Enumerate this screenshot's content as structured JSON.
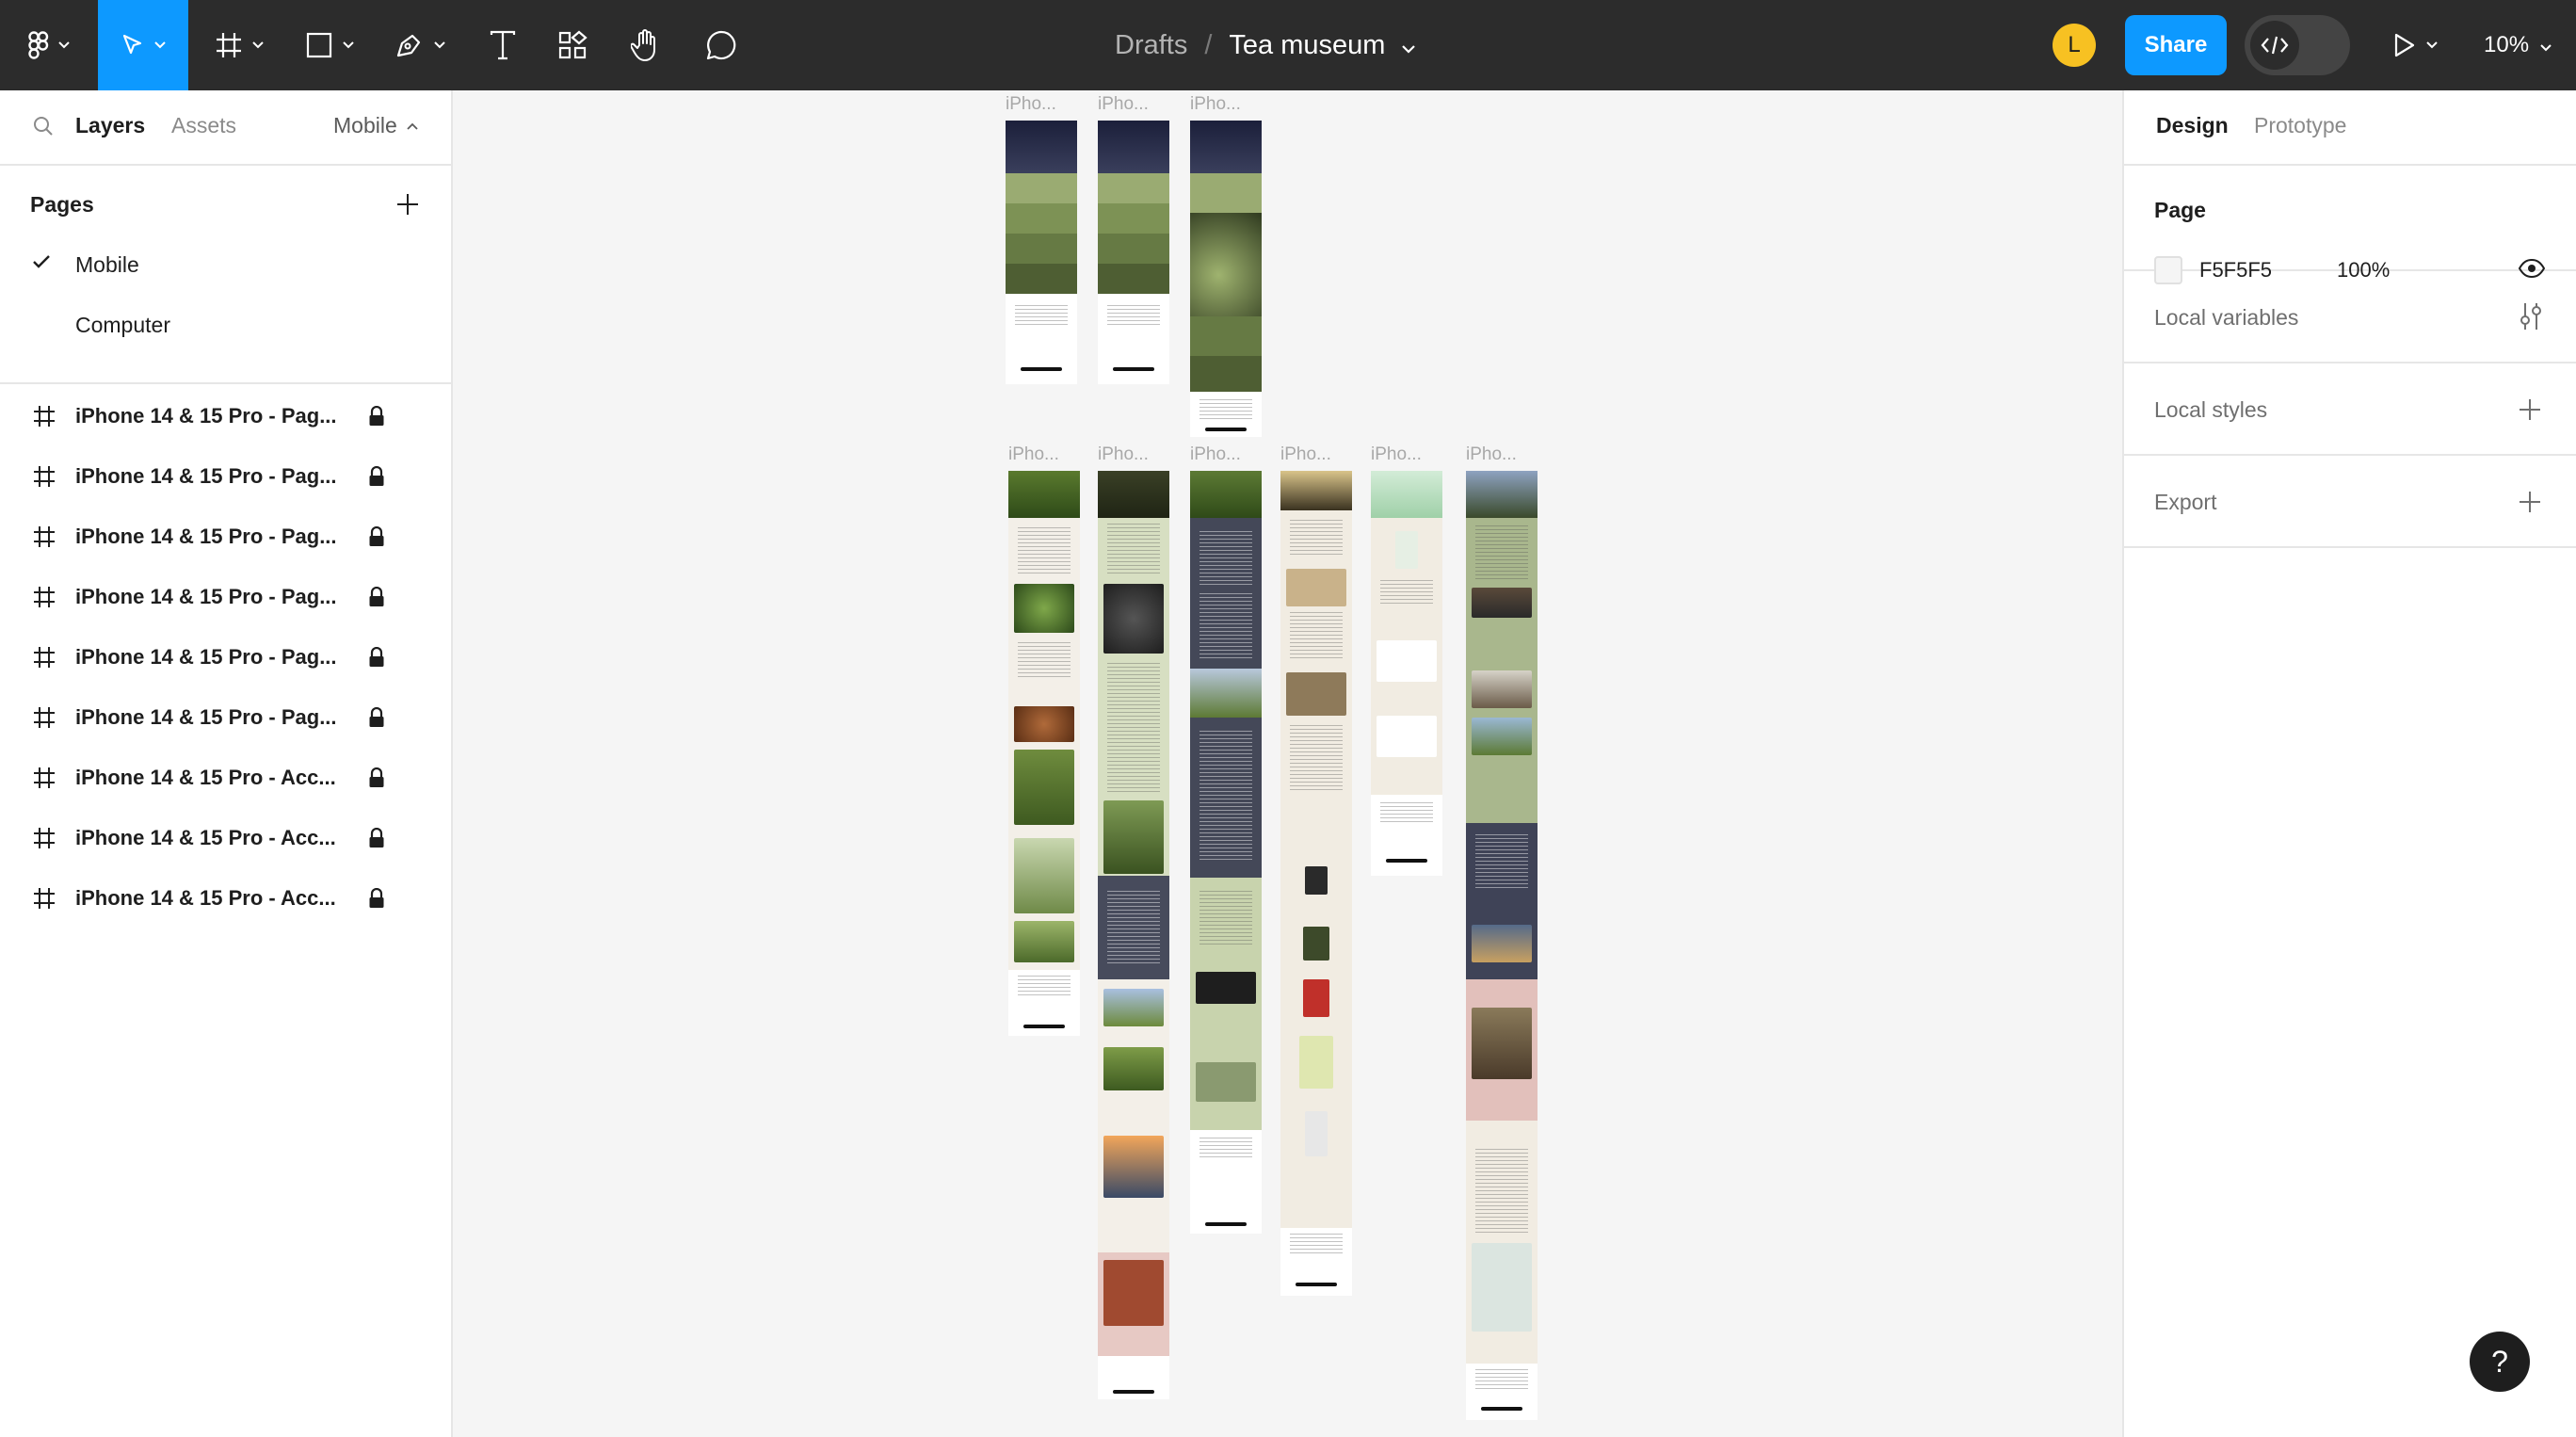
{
  "toolbar": {
    "breadcrumb_drafts": "Drafts",
    "breadcrumb_sep": "/",
    "file_name": "Tea museum",
    "avatar_initial": "L",
    "share_label": "Share",
    "zoom_label": "10%",
    "accent": "#0d99ff"
  },
  "left_panel": {
    "tab_layers": "Layers",
    "tab_assets": "Assets",
    "page_dropdown": "Mobile",
    "pages_header": "Pages",
    "pages": [
      {
        "label": "Mobile",
        "selected": true
      },
      {
        "label": "Computer",
        "selected": false
      }
    ],
    "layers": [
      {
        "label": "iPhone 14 & 15 Pro - Pag..."
      },
      {
        "label": "iPhone 14 & 15 Pro - Pag..."
      },
      {
        "label": "iPhone 14 & 15 Pro - Pag..."
      },
      {
        "label": "iPhone 14 & 15 Pro - Pag..."
      },
      {
        "label": "iPhone 14 & 15 Pro - Pag..."
      },
      {
        "label": "iPhone 14 & 15 Pro - Pag..."
      },
      {
        "label": "iPhone 14 & 15 Pro - Acc..."
      },
      {
        "label": "iPhone 14 & 15 Pro - Acc..."
      },
      {
        "label": "iPhone 14 & 15 Pro - Acc..."
      }
    ]
  },
  "right_panel": {
    "tab_design": "Design",
    "tab_prototype": "Prototype",
    "page_header": "Page",
    "page_color": "F5F5F5",
    "page_opacity": "100%",
    "local_variables": "Local variables",
    "local_styles": "Local styles",
    "export": "Export"
  },
  "canvas": {
    "frame_label": "iPho..."
  },
  "help_label": "?"
}
